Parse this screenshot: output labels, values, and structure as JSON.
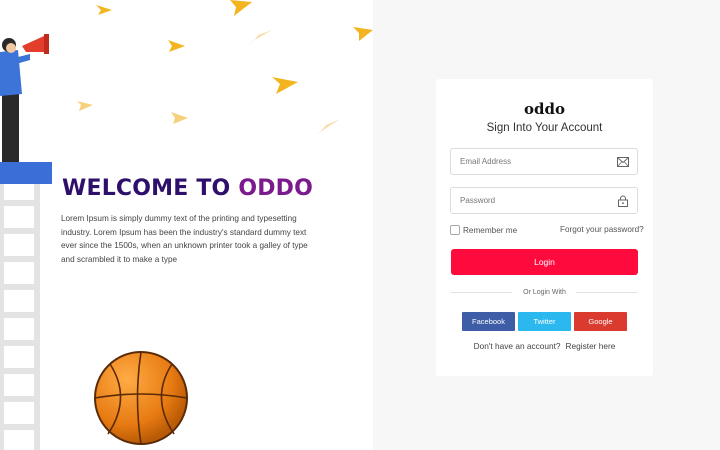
{
  "hero": {
    "title_part1": "WELCOME TO",
    "title_part2": "ODDO",
    "description": "Lorem Ipsum is simply dummy text of the printing and typesetting industry. Lorem Ipsum has been the industry's standard dummy text ever since the 1500s, when an unknown printer took a galley of type and scrambled it to make a type"
  },
  "login": {
    "brand": "oddo",
    "subtitle": "Sign Into Your Account",
    "email_placeholder": "Email Address",
    "password_placeholder": "Password",
    "remember_label": "Remember me",
    "forgot_label": "Forgot your password?",
    "login_button": "Login",
    "or_label": "Or Login With",
    "social": [
      "Facebook",
      "Twitter",
      "Google"
    ],
    "no_account": "Don't have an account?",
    "register_link": "Register here"
  },
  "colors": {
    "title_dark": "#2e0f6b",
    "title_accent": "#7a1a8c",
    "login_button": "#ff0a3c",
    "facebook": "#3d5da6",
    "twitter": "#2bb8ee",
    "google": "#db3a2f",
    "right_background": "#f7f7f7"
  },
  "icons": [
    "envelope-icon",
    "lock-icon",
    "paper-plane-icon",
    "megaphone-icon",
    "basketball-icon",
    "ladder-icon"
  ]
}
